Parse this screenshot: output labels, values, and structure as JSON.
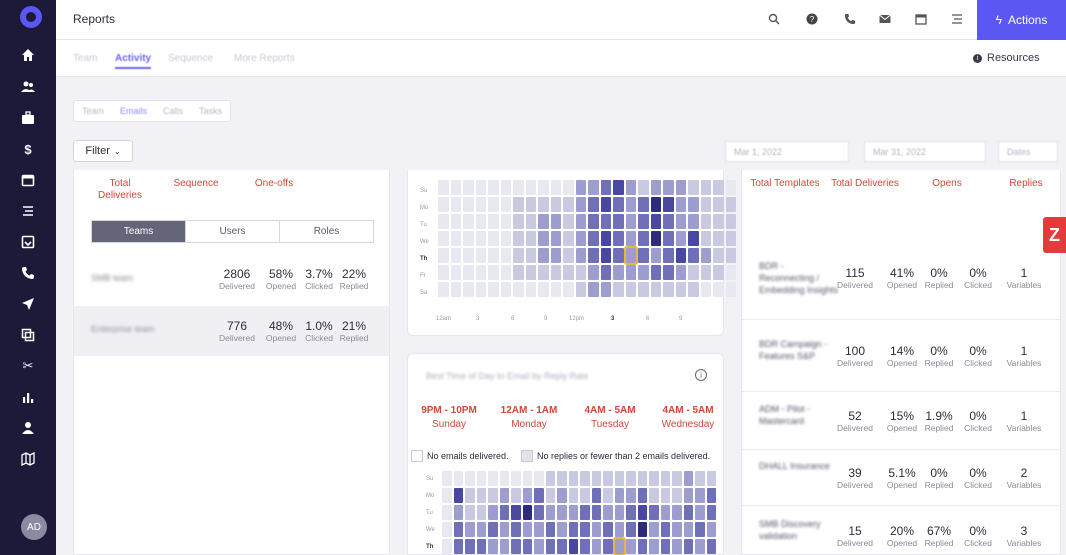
{
  "header": {
    "title": "Reports",
    "actions_label": "Actions"
  },
  "subnav": {
    "tabs": [
      {
        "label": "Team",
        "active": false
      },
      {
        "label": "Activity",
        "active": true
      },
      {
        "label": "Sequence",
        "active": false
      },
      {
        "label": "More Reports",
        "active": false
      }
    ],
    "resources_label": "Resources"
  },
  "segmented": [
    "Team",
    "Emails",
    "Calls",
    "Tasks"
  ],
  "filter": {
    "label": "Filter"
  },
  "date_range": {
    "start": "Mar 1, 2022",
    "end": "Mar 31, 2022",
    "preset": "Dates"
  },
  "deliveries_stats": [
    {
      "label": "Total Deliveries"
    },
    {
      "label": "Sequence"
    },
    {
      "label": "One-offs"
    }
  ],
  "toggle": {
    "options": [
      "Teams",
      "Users",
      "Roles"
    ],
    "selected": "Teams"
  },
  "teams": [
    {
      "name": "SMB team",
      "delivered": "2806",
      "opened": "58%",
      "clicked": "3.7%",
      "replied": "22%"
    },
    {
      "name": "Enterprise team",
      "delivered": "776",
      "opened": "48%",
      "clicked": "1.0%",
      "replied": "21%"
    }
  ],
  "metric_labels": {
    "delivered": "Delivered",
    "opened": "Opened",
    "clicked": "Clicked",
    "replied": "Replied",
    "variables": "Variables"
  },
  "heatmap": {
    "days": [
      "Su",
      "Mo",
      "Tu",
      "We",
      "Th",
      "Fr",
      "Sa"
    ],
    "hours": [
      "12am",
      "3",
      "6",
      "9",
      "12pm",
      "3",
      "6",
      "9"
    ],
    "intensity_rows": [
      [
        0,
        0,
        0,
        0,
        0,
        0,
        0,
        0,
        0,
        0,
        0,
        2,
        2,
        3,
        4,
        2,
        1,
        2,
        2,
        2,
        1,
        1,
        1,
        0
      ],
      [
        0,
        0,
        0,
        0,
        0,
        0,
        1,
        1,
        1,
        1,
        1,
        2,
        3,
        4,
        3,
        2,
        3,
        5,
        4,
        2,
        2,
        1,
        1,
        1
      ],
      [
        0,
        0,
        0,
        0,
        0,
        0,
        1,
        1,
        2,
        2,
        1,
        2,
        3,
        3,
        3,
        2,
        3,
        4,
        3,
        2,
        2,
        1,
        1,
        1
      ],
      [
        0,
        0,
        0,
        0,
        0,
        0,
        1,
        1,
        2,
        2,
        1,
        2,
        3,
        4,
        3,
        2,
        3,
        5,
        3,
        2,
        4,
        1,
        1,
        1
      ],
      [
        0,
        0,
        0,
        0,
        0,
        0,
        1,
        1,
        2,
        2,
        1,
        2,
        3,
        4,
        3,
        2,
        3,
        2,
        3,
        4,
        3,
        2,
        1,
        1
      ],
      [
        0,
        0,
        0,
        0,
        0,
        0,
        1,
        1,
        1,
        1,
        1,
        1,
        2,
        3,
        2,
        2,
        2,
        3,
        3,
        2,
        1,
        1,
        1,
        0
      ],
      [
        0,
        0,
        0,
        0,
        0,
        0,
        0,
        0,
        0,
        0,
        0,
        1,
        2,
        2,
        1,
        1,
        1,
        1,
        1,
        1,
        1,
        0,
        0,
        0
      ]
    ],
    "highlight": {
      "day": "Th",
      "hour": "3"
    }
  },
  "best_time": {
    "title": "Best Time of Day to Email by Reply Rate",
    "slots": [
      {
        "time": "9PM - 10PM",
        "day": "Sunday"
      },
      {
        "time": "12AM - 1AM",
        "day": "Monday"
      },
      {
        "time": "4AM - 5AM",
        "day": "Tuesday"
      },
      {
        "time": "4AM - 5AM",
        "day": "Wednesday"
      }
    ],
    "legend": [
      "No emails delivered.",
      "No replies or fewer than 2 emails delivered."
    ],
    "days": [
      "Su",
      "Mo",
      "Tu",
      "We",
      "Th"
    ]
  },
  "templates_stats": [
    {
      "label": "Total Templates"
    },
    {
      "label": "Total Deliveries"
    },
    {
      "label": "Opens"
    },
    {
      "label": "Replies"
    }
  ],
  "templates": [
    {
      "name": "BDR - Reconnecting / Embedding Insights",
      "delivered": "115",
      "opened": "41%",
      "replied": "0%",
      "clicked": "0%",
      "variables": "1"
    },
    {
      "name": "BDR Campaign - Features S&P",
      "delivered": "100",
      "opened": "14%",
      "replied": "0%",
      "clicked": "0%",
      "variables": "1"
    },
    {
      "name": "ADM - Pilot - Mastercard",
      "delivered": "52",
      "opened": "15%",
      "replied": "1.9%",
      "clicked": "0%",
      "variables": "1"
    },
    {
      "name": "DHALL Insurance",
      "delivered": "39",
      "opened": "5.1%",
      "replied": "0%",
      "clicked": "0%",
      "variables": "2"
    },
    {
      "name": "SMB Discovery validation",
      "delivered": "15",
      "opened": "20%",
      "replied": "67%",
      "clicked": "0%",
      "variables": "3"
    }
  ],
  "user": {
    "initials": "AD"
  }
}
